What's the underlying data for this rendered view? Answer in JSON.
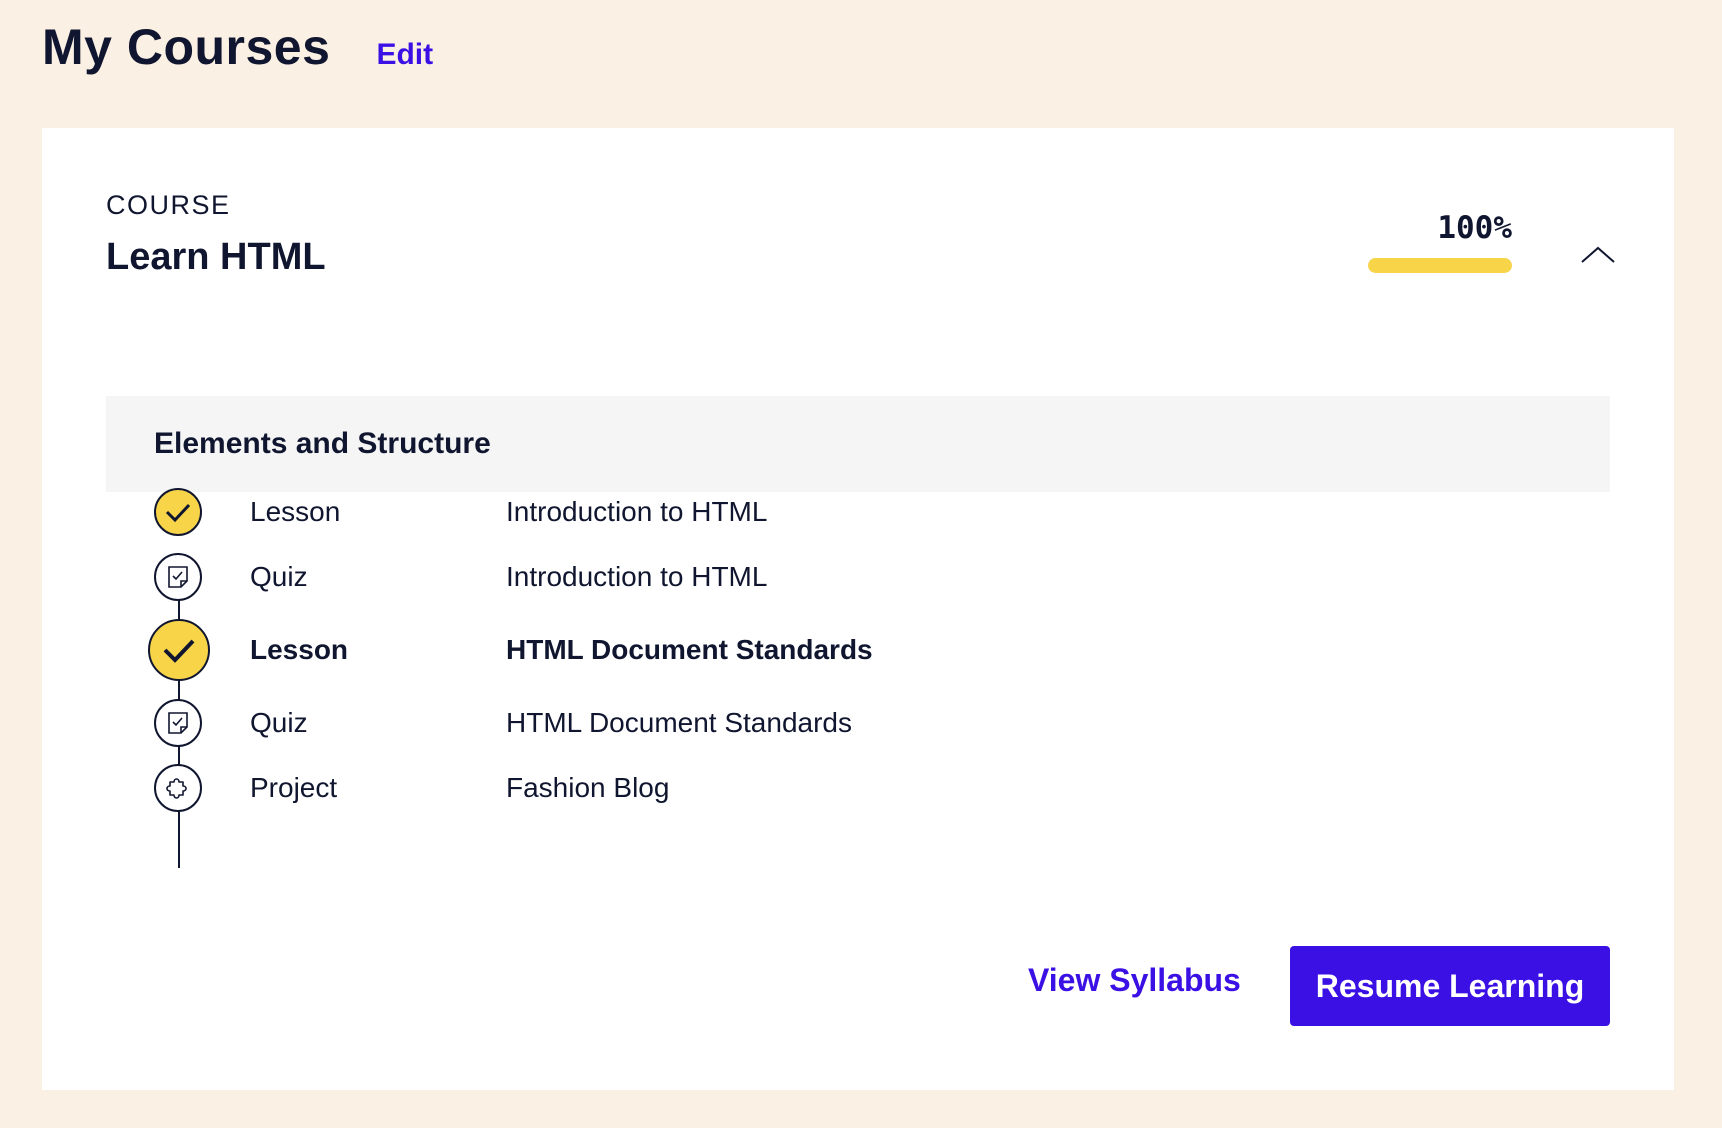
{
  "header": {
    "title": "My Courses",
    "edit_label": "Edit"
  },
  "course": {
    "eyebrow": "COURSE",
    "title": "Learn HTML",
    "progress_label": "100%",
    "progress_fraction": 1.0
  },
  "module": {
    "title": "Elements and Structure",
    "items": [
      {
        "type": "Lesson",
        "name": "Introduction to HTML",
        "icon": "check-circle-icon",
        "completed": true,
        "current": false
      },
      {
        "type": "Quiz",
        "name": "Introduction to HTML",
        "icon": "quiz-icon",
        "completed": false,
        "current": false
      },
      {
        "type": "Lesson",
        "name": "HTML Document Standards",
        "icon": "check-circle-icon",
        "completed": true,
        "current": true
      },
      {
        "type": "Quiz",
        "name": "HTML Document Standards",
        "icon": "quiz-icon",
        "completed": false,
        "current": false
      },
      {
        "type": "Project",
        "name": "Fashion Blog",
        "icon": "puzzle-icon",
        "completed": false,
        "current": false
      }
    ]
  },
  "actions": {
    "view_syllabus_label": "View Syllabus",
    "resume_label": "Resume Learning"
  },
  "colors": {
    "accent": "#3a10e5",
    "progress": "#f7d448",
    "background": "#fbf0e4"
  }
}
